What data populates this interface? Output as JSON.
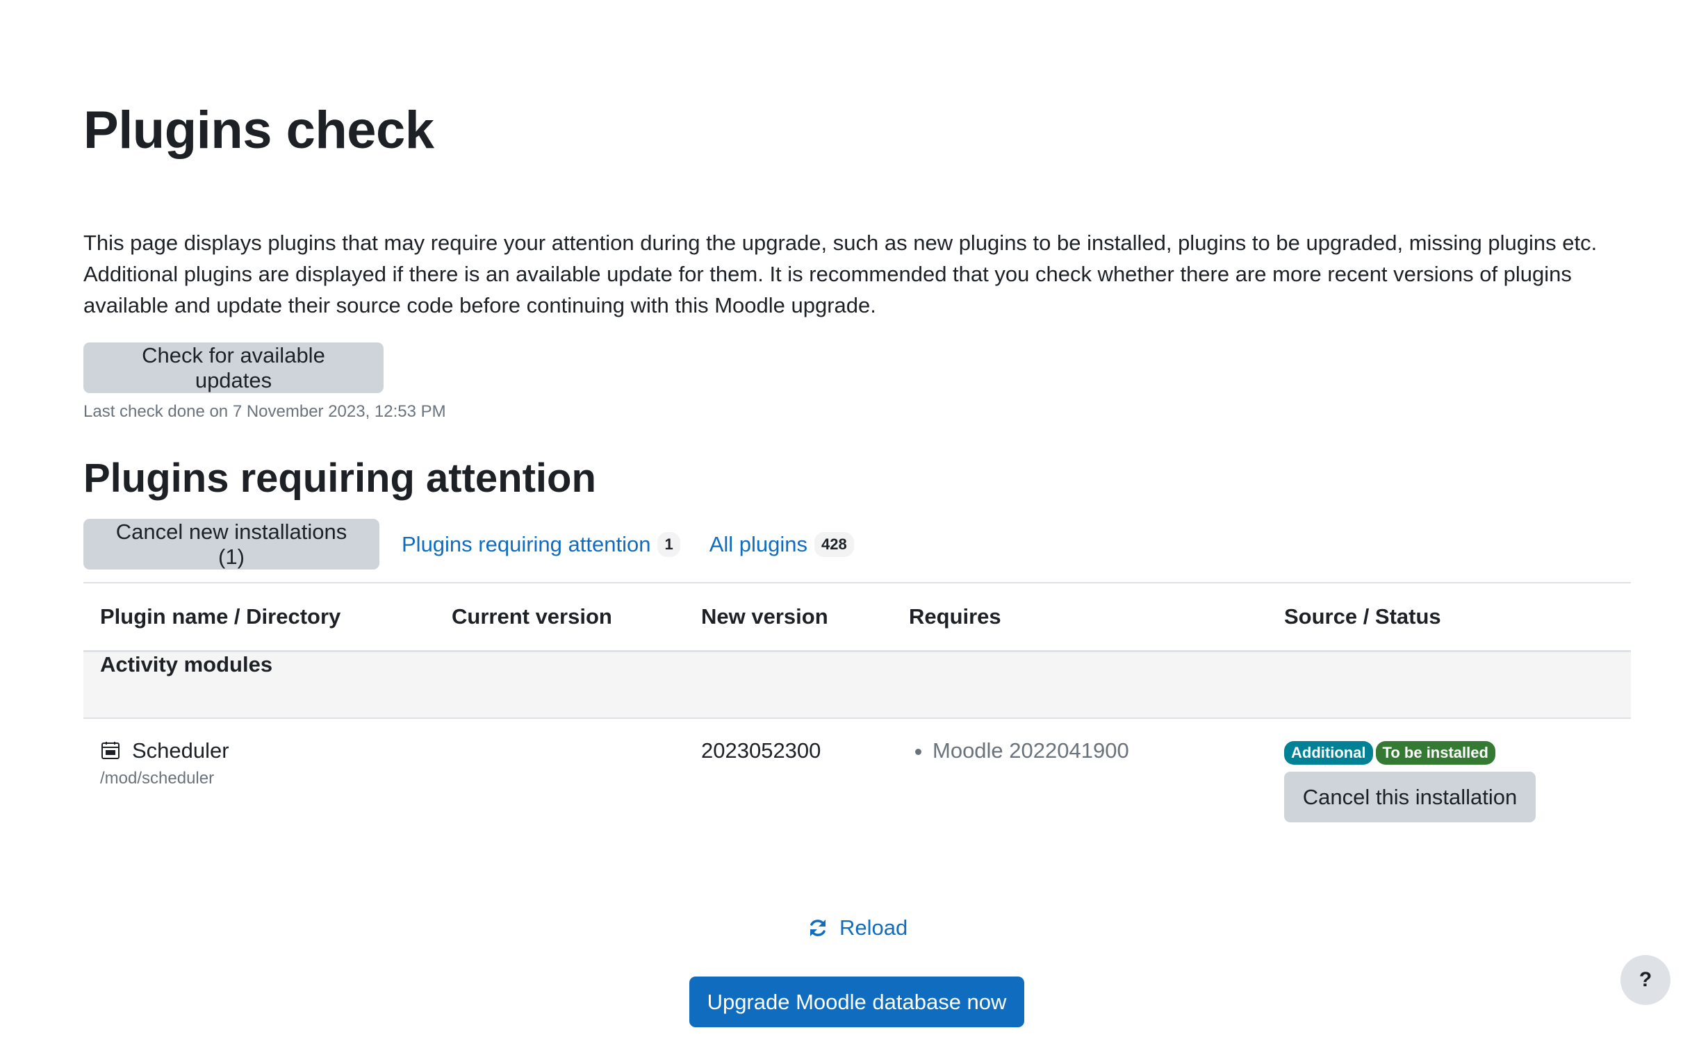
{
  "page": {
    "title": "Plugins check",
    "intro": "This page displays plugins that may require your attention during the upgrade, such as new plugins to be installed, plugins to be upgraded, missing plugins etc. Additional plugins are displayed if there is an available update for them. It is recommended that you check whether there are more recent versions of plugins available and update their source code before continuing with this Moodle upgrade.",
    "check_updates_label": "Check for available updates",
    "last_check": "Last check done on 7 November 2023, 12:53 PM",
    "subtitle": "Plugins requiring attention"
  },
  "tabs": {
    "cancel_new_label": "Cancel new installations (1)",
    "attention_label": "Plugins requiring attention",
    "attention_count": "1",
    "all_label": "All plugins",
    "all_count": "428"
  },
  "table": {
    "headers": [
      "Plugin name / Directory",
      "Current version",
      "New version",
      "Requires",
      "Source / Status"
    ],
    "group": "Activity modules",
    "rows": [
      {
        "name": "Scheduler",
        "directory": "/mod/scheduler",
        "icon": "calendar-icon",
        "current_version": "",
        "new_version": "2023052300",
        "requires": [
          "Moodle 2022041900"
        ],
        "badges": [
          {
            "label": "Additional",
            "color": "#008196"
          },
          {
            "label": "To be installed",
            "color": "#357a32"
          }
        ],
        "action_label": "Cancel this installation"
      }
    ]
  },
  "footer": {
    "reload_label": "Reload",
    "reload_icon": "refresh-icon",
    "upgrade_label": "Upgrade Moodle database now",
    "help_label": "?"
  },
  "colors": {
    "link": "#0f6cbf",
    "primary": "#0f6cbf",
    "secondary_button": "#ced4da",
    "muted_text": "#6a737b"
  }
}
